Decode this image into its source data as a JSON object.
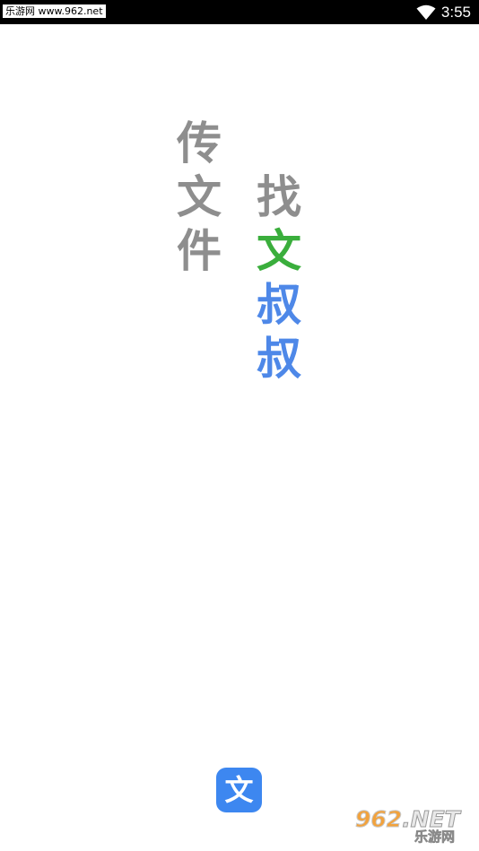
{
  "status_bar": {
    "watermark": "乐游网 www.962.net",
    "time": "3:55",
    "wifi_icon": "wifi-icon",
    "background": "#000000"
  },
  "splash": {
    "left_column": [
      "传",
      "文",
      "件"
    ],
    "right_column": [
      "找",
      "文",
      "叔",
      "叔"
    ],
    "colors": {
      "gray": "#8e8e8e",
      "green": "#3aae3c",
      "blue": "#4e88e8"
    }
  },
  "logo": {
    "glyph": "文",
    "background": "#3d87f0"
  },
  "watermark_bottom": {
    "brand": "962",
    "suffix": ".NET",
    "name": "乐游网"
  }
}
